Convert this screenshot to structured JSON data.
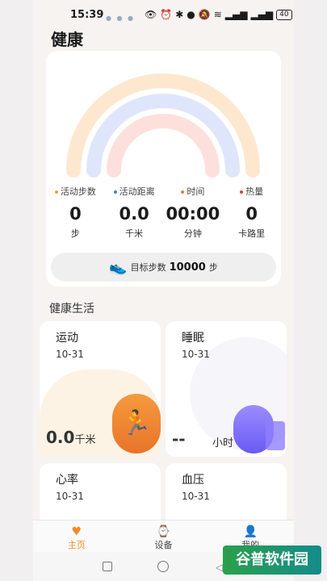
{
  "status_bar": {
    "time": "15:39",
    "battery": "40"
  },
  "header": {
    "title": "健康"
  },
  "summary": {
    "stats": [
      {
        "label": "活动步数",
        "value": "0",
        "unit": "步",
        "color": "#f0a030"
      },
      {
        "label": "活动距离",
        "value": "0.0",
        "unit": "千米",
        "color": "#4a7de0"
      },
      {
        "label": "时间",
        "value": "00:00",
        "unit": "分钟",
        "color": "#f07a30"
      },
      {
        "label": "热量",
        "value": "0",
        "unit": "卡路里",
        "color": "#e03a3a"
      }
    ],
    "goal": {
      "prefix": "目标步数",
      "value": "10000",
      "suffix": "步"
    },
    "rainbow_colors": [
      "#fde8cf",
      "#dfe6fb",
      "#fde0dc"
    ]
  },
  "section": {
    "title": "健康生活"
  },
  "tiles": {
    "sport": {
      "title": "运动",
      "date": "10-31",
      "value": "0.0",
      "unit": "千米"
    },
    "sleep": {
      "title": "睡眠",
      "date": "10-31",
      "value": "--",
      "unit": "小时"
    },
    "heart": {
      "title": "心率",
      "date": "10-31"
    },
    "bp": {
      "title": "血压",
      "date": "10-31"
    }
  },
  "tabbar": {
    "items": [
      {
        "label": "主页",
        "icon": "heart-icon"
      },
      {
        "label": "设备",
        "icon": "watch-icon"
      },
      {
        "label": "我的",
        "icon": "person-icon"
      }
    ]
  },
  "watermark": {
    "text": "谷普软件园"
  }
}
